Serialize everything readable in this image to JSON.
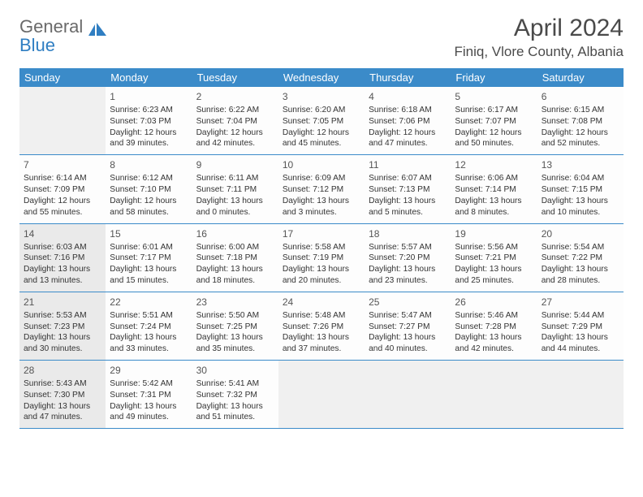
{
  "brand": {
    "part1": "General",
    "part2": "Blue"
  },
  "title": "April 2024",
  "location": "Finiq, Vlore County, Albania",
  "weekdays": [
    "Sunday",
    "Monday",
    "Tuesday",
    "Wednesday",
    "Thursday",
    "Friday",
    "Saturday"
  ],
  "weeks": [
    [
      {
        "blank": true
      },
      {
        "day": "1",
        "sunrise": "Sunrise: 6:23 AM",
        "sunset": "Sunset: 7:03 PM",
        "daylight1": "Daylight: 12 hours",
        "daylight2": "and 39 minutes."
      },
      {
        "day": "2",
        "sunrise": "Sunrise: 6:22 AM",
        "sunset": "Sunset: 7:04 PM",
        "daylight1": "Daylight: 12 hours",
        "daylight2": "and 42 minutes."
      },
      {
        "day": "3",
        "sunrise": "Sunrise: 6:20 AM",
        "sunset": "Sunset: 7:05 PM",
        "daylight1": "Daylight: 12 hours",
        "daylight2": "and 45 minutes."
      },
      {
        "day": "4",
        "sunrise": "Sunrise: 6:18 AM",
        "sunset": "Sunset: 7:06 PM",
        "daylight1": "Daylight: 12 hours",
        "daylight2": "and 47 minutes."
      },
      {
        "day": "5",
        "sunrise": "Sunrise: 6:17 AM",
        "sunset": "Sunset: 7:07 PM",
        "daylight1": "Daylight: 12 hours",
        "daylight2": "and 50 minutes."
      },
      {
        "day": "6",
        "sunrise": "Sunrise: 6:15 AM",
        "sunset": "Sunset: 7:08 PM",
        "daylight1": "Daylight: 12 hours",
        "daylight2": "and 52 minutes."
      }
    ],
    [
      {
        "day": "7",
        "sunrise": "Sunrise: 6:14 AM",
        "sunset": "Sunset: 7:09 PM",
        "daylight1": "Daylight: 12 hours",
        "daylight2": "and 55 minutes."
      },
      {
        "day": "8",
        "sunrise": "Sunrise: 6:12 AM",
        "sunset": "Sunset: 7:10 PM",
        "daylight1": "Daylight: 12 hours",
        "daylight2": "and 58 minutes."
      },
      {
        "day": "9",
        "sunrise": "Sunrise: 6:11 AM",
        "sunset": "Sunset: 7:11 PM",
        "daylight1": "Daylight: 13 hours",
        "daylight2": "and 0 minutes."
      },
      {
        "day": "10",
        "sunrise": "Sunrise: 6:09 AM",
        "sunset": "Sunset: 7:12 PM",
        "daylight1": "Daylight: 13 hours",
        "daylight2": "and 3 minutes."
      },
      {
        "day": "11",
        "sunrise": "Sunrise: 6:07 AM",
        "sunset": "Sunset: 7:13 PM",
        "daylight1": "Daylight: 13 hours",
        "daylight2": "and 5 minutes."
      },
      {
        "day": "12",
        "sunrise": "Sunrise: 6:06 AM",
        "sunset": "Sunset: 7:14 PM",
        "daylight1": "Daylight: 13 hours",
        "daylight2": "and 8 minutes."
      },
      {
        "day": "13",
        "sunrise": "Sunrise: 6:04 AM",
        "sunset": "Sunset: 7:15 PM",
        "daylight1": "Daylight: 13 hours",
        "daylight2": "and 10 minutes."
      }
    ],
    [
      {
        "day": "14",
        "shaded": true,
        "sunrise": "Sunrise: 6:03 AM",
        "sunset": "Sunset: 7:16 PM",
        "daylight1": "Daylight: 13 hours",
        "daylight2": "and 13 minutes."
      },
      {
        "day": "15",
        "sunrise": "Sunrise: 6:01 AM",
        "sunset": "Sunset: 7:17 PM",
        "daylight1": "Daylight: 13 hours",
        "daylight2": "and 15 minutes."
      },
      {
        "day": "16",
        "sunrise": "Sunrise: 6:00 AM",
        "sunset": "Sunset: 7:18 PM",
        "daylight1": "Daylight: 13 hours",
        "daylight2": "and 18 minutes."
      },
      {
        "day": "17",
        "sunrise": "Sunrise: 5:58 AM",
        "sunset": "Sunset: 7:19 PM",
        "daylight1": "Daylight: 13 hours",
        "daylight2": "and 20 minutes."
      },
      {
        "day": "18",
        "sunrise": "Sunrise: 5:57 AM",
        "sunset": "Sunset: 7:20 PM",
        "daylight1": "Daylight: 13 hours",
        "daylight2": "and 23 minutes."
      },
      {
        "day": "19",
        "sunrise": "Sunrise: 5:56 AM",
        "sunset": "Sunset: 7:21 PM",
        "daylight1": "Daylight: 13 hours",
        "daylight2": "and 25 minutes."
      },
      {
        "day": "20",
        "sunrise": "Sunrise: 5:54 AM",
        "sunset": "Sunset: 7:22 PM",
        "daylight1": "Daylight: 13 hours",
        "daylight2": "and 28 minutes."
      }
    ],
    [
      {
        "day": "21",
        "shaded": true,
        "sunrise": "Sunrise: 5:53 AM",
        "sunset": "Sunset: 7:23 PM",
        "daylight1": "Daylight: 13 hours",
        "daylight2": "and 30 minutes."
      },
      {
        "day": "22",
        "sunrise": "Sunrise: 5:51 AM",
        "sunset": "Sunset: 7:24 PM",
        "daylight1": "Daylight: 13 hours",
        "daylight2": "and 33 minutes."
      },
      {
        "day": "23",
        "sunrise": "Sunrise: 5:50 AM",
        "sunset": "Sunset: 7:25 PM",
        "daylight1": "Daylight: 13 hours",
        "daylight2": "and 35 minutes."
      },
      {
        "day": "24",
        "sunrise": "Sunrise: 5:48 AM",
        "sunset": "Sunset: 7:26 PM",
        "daylight1": "Daylight: 13 hours",
        "daylight2": "and 37 minutes."
      },
      {
        "day": "25",
        "sunrise": "Sunrise: 5:47 AM",
        "sunset": "Sunset: 7:27 PM",
        "daylight1": "Daylight: 13 hours",
        "daylight2": "and 40 minutes."
      },
      {
        "day": "26",
        "sunrise": "Sunrise: 5:46 AM",
        "sunset": "Sunset: 7:28 PM",
        "daylight1": "Daylight: 13 hours",
        "daylight2": "and 42 minutes."
      },
      {
        "day": "27",
        "sunrise": "Sunrise: 5:44 AM",
        "sunset": "Sunset: 7:29 PM",
        "daylight1": "Daylight: 13 hours",
        "daylight2": "and 44 minutes."
      }
    ],
    [
      {
        "day": "28",
        "shaded": true,
        "sunrise": "Sunrise: 5:43 AM",
        "sunset": "Sunset: 7:30 PM",
        "daylight1": "Daylight: 13 hours",
        "daylight2": "and 47 minutes."
      },
      {
        "day": "29",
        "sunrise": "Sunrise: 5:42 AM",
        "sunset": "Sunset: 7:31 PM",
        "daylight1": "Daylight: 13 hours",
        "daylight2": "and 49 minutes."
      },
      {
        "day": "30",
        "sunrise": "Sunrise: 5:41 AM",
        "sunset": "Sunset: 7:32 PM",
        "daylight1": "Daylight: 13 hours",
        "daylight2": "and 51 minutes."
      },
      {
        "blank": true
      },
      {
        "blank": true
      },
      {
        "blank": true
      },
      {
        "blank": true
      }
    ]
  ]
}
